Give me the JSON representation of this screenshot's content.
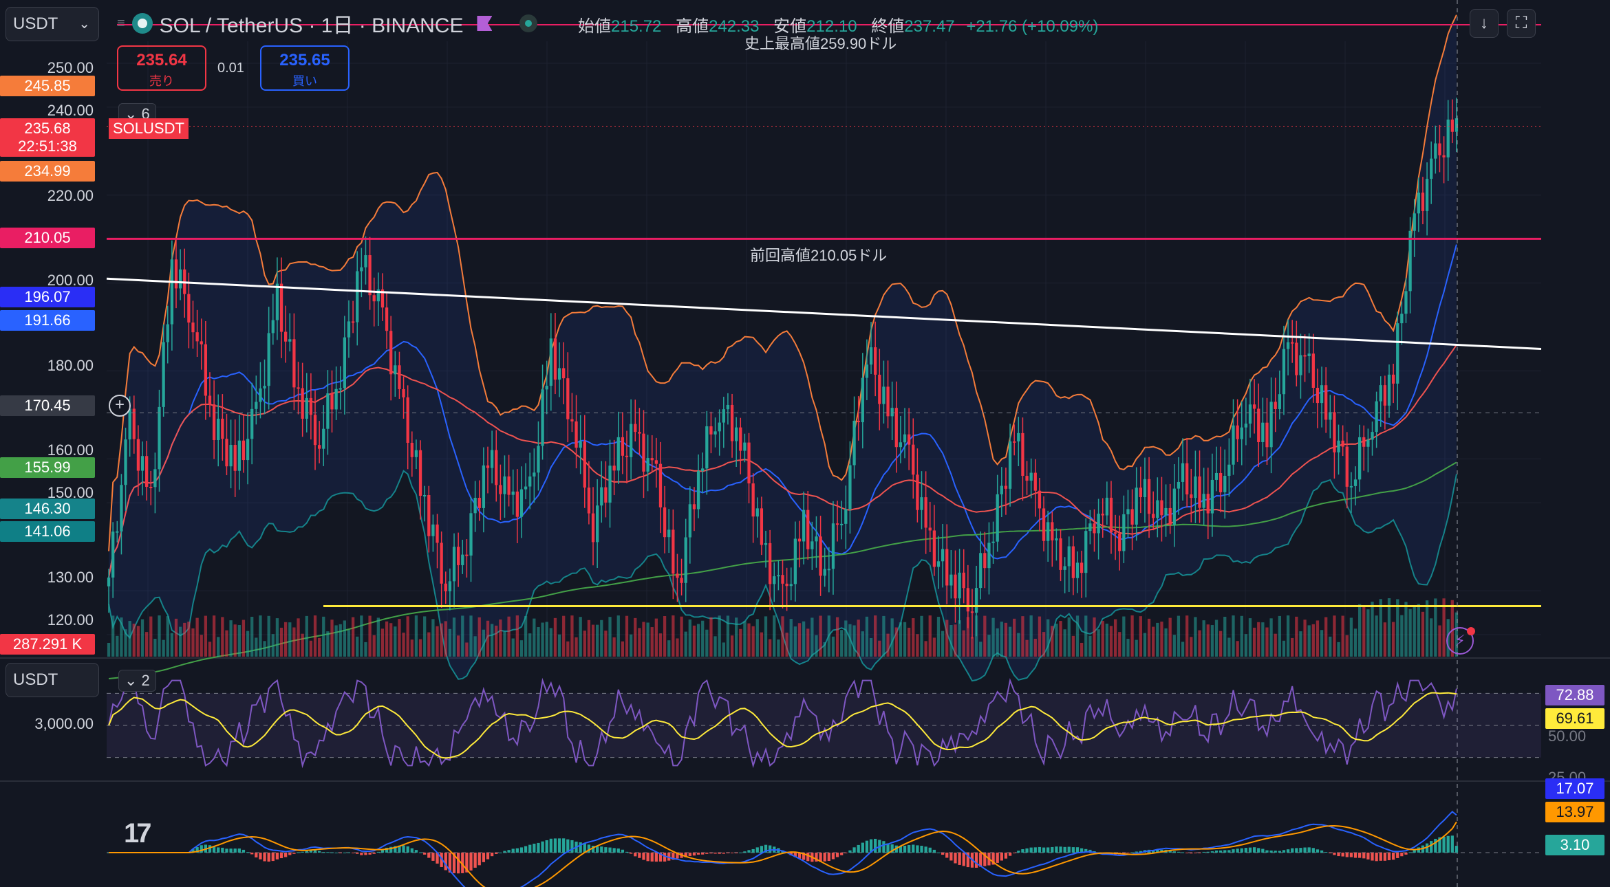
{
  "header": {
    "currency": "USDT",
    "symbol_title": "SOL / TetherUS · 1日 · BINANCE",
    "ohlc": {
      "open_label": "始値",
      "open": "215.72",
      "high_label": "高値",
      "high": "242.33",
      "low_label": "安値",
      "low": "212.10",
      "close_label": "終値",
      "close": "237.47",
      "change": "+21.76 (+10.09%)"
    },
    "icons": [
      "download-arrow-icon",
      "fullscreen-icon"
    ]
  },
  "trade": {
    "sell_price": "235.64",
    "sell_label": "売り",
    "spread": "0.01",
    "buy_price": "235.65",
    "buy_label": "買い"
  },
  "indicators_collapse": "6",
  "pair_tag": "SOLUSDT",
  "annotations": {
    "ath": "史上最高値259.90ドル",
    "prev_high": "前回高値210.05ドル"
  },
  "price_axis": {
    "ticks": [
      "250.00",
      "240.00",
      "220.00",
      "200.00",
      "180.00",
      "160.00",
      "150.00",
      "130.00",
      "120.00"
    ]
  },
  "price_tags": {
    "t245": "245.85",
    "current": "235.68",
    "countdown": "22:51:38",
    "t234": "234.99",
    "t210": "210.05",
    "t196": "196.07",
    "t191": "191.66",
    "crosshair": "170.45",
    "t155": "155.99",
    "t146": "146.30",
    "t141": "141.06",
    "volume": "287.291 K"
  },
  "rsi_pane": {
    "currency": "USDT",
    "collapse": "2",
    "axis_tick": "3,000.00",
    "right_ticks": [
      "50.00",
      "25.00"
    ],
    "value_rsi": "72.88",
    "value_ma": "69.61"
  },
  "macd_pane": {
    "macd": "17.07",
    "signal": "13.97",
    "hist": "3.10"
  },
  "colors": {
    "bg": "#131722",
    "up": "#26a69a",
    "down": "#f23645",
    "resistance": "#e91e63",
    "trendline": "#ffffff",
    "support": "#ffeb3b",
    "rsi": "#7e57c2",
    "macd": "#2962ff",
    "signal": "#ff9800"
  },
  "chart_data": {
    "type": "candlestick",
    "symbol": "SOL / TetherUS",
    "timeframe": "1日",
    "exchange": "BINANCE",
    "price_ylim": [
      115,
      255
    ],
    "horizontal_levels": [
      {
        "name": "前回高値",
        "value": 210.05
      },
      {
        "name": "support",
        "value": 126.5
      }
    ],
    "trendline": {
      "start": 201.0,
      "end": 185.0
    },
    "close_path": [
      133,
      168,
      150,
      205,
      192,
      168,
      158,
      170,
      196,
      175,
      165,
      180,
      205,
      192,
      170,
      150,
      132,
      142,
      160,
      150,
      152,
      185,
      170,
      145,
      160,
      165,
      155,
      130,
      158,
      172,
      165,
      140,
      128,
      145,
      135,
      152,
      185,
      170,
      160,
      140,
      133,
      128,
      145,
      165,
      150,
      138,
      135,
      150,
      143,
      153,
      145,
      155,
      150,
      158,
      172,
      165,
      185,
      180,
      168,
      155,
      170,
      180,
      215,
      228,
      237
    ],
    "last_close": 237.47,
    "rsi": {
      "current": 72.88,
      "ma": 69.61,
      "levels": [
        70,
        50,
        30
      ]
    },
    "macd": {
      "macd": 17.07,
      "signal": 13.97,
      "histogram": 3.1
    }
  }
}
